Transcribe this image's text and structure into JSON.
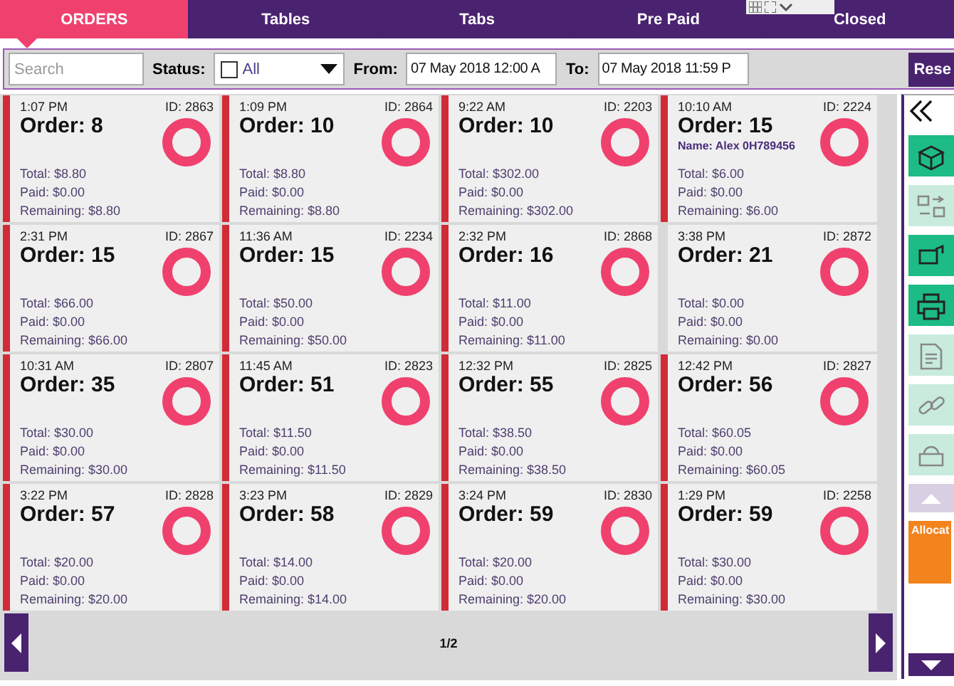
{
  "tabs": [
    {
      "label": "ORDERS",
      "selected": true
    },
    {
      "label": "Tables",
      "selected": false
    },
    {
      "label": "Tabs",
      "selected": false
    },
    {
      "label": "Pre Paid",
      "selected": false
    },
    {
      "label": "Closed",
      "selected": false
    }
  ],
  "filters": {
    "search_placeholder": "Search",
    "status_label": "Status:",
    "status_checked": false,
    "status_value": "All",
    "from_label": "From:",
    "from_value": "07 May 2018 12:00 A",
    "to_label": "To:",
    "to_value": "07 May 2018 11:59 P",
    "reset": "Rese"
  },
  "orders": [
    {
      "time": "1:07 PM",
      "id": "ID: 2863",
      "title": "Order: 8",
      "total": "Total: $8.80",
      "paid": "Paid: $0.00",
      "remaining": "Remaining: $8.80",
      "flagged": true
    },
    {
      "time": "1:09 PM",
      "id": "ID: 2864",
      "title": "Order: 10",
      "total": "Total: $8.80",
      "paid": "Paid: $0.00",
      "remaining": "Remaining: $8.80",
      "flagged": true
    },
    {
      "time": "9:22 AM",
      "id": "ID: 2203",
      "title": "Order: 10",
      "total": "Total: $302.00",
      "paid": "Paid: $0.00",
      "remaining": "Remaining: $302.00",
      "flagged": true
    },
    {
      "time": "10:10 AM",
      "id": "ID: 2224",
      "title": "Order: 15",
      "name": "Name: Alex 0H789456",
      "total": "Total: $6.00",
      "paid": "Paid: $0.00",
      "remaining": "Remaining: $6.00",
      "flagged": true
    },
    {
      "time": "2:31 PM",
      "id": "ID: 2867",
      "title": "Order: 15",
      "total": "Total: $66.00",
      "paid": "Paid: $0.00",
      "remaining": "Remaining: $66.00",
      "flagged": true
    },
    {
      "time": "11:36 AM",
      "id": "ID: 2234",
      "title": "Order: 15",
      "total": "Total: $50.00",
      "paid": "Paid: $0.00",
      "remaining": "Remaining: $50.00",
      "flagged": true
    },
    {
      "time": "2:32 PM",
      "id": "ID: 2868",
      "title": "Order: 16",
      "total": "Total: $11.00",
      "paid": "Paid: $0.00",
      "remaining": "Remaining: $11.00",
      "flagged": true
    },
    {
      "time": "3:38 PM",
      "id": "ID: 2872",
      "title": "Order: 21",
      "total": "Total: $0.00",
      "paid": "Paid: $0.00",
      "remaining": "Remaining: $0.00",
      "flagged": false
    },
    {
      "time": "10:31 AM",
      "id": "ID: 2807",
      "title": "Order: 35",
      "total": "Total: $30.00",
      "paid": "Paid: $0.00",
      "remaining": "Remaining: $30.00",
      "flagged": true
    },
    {
      "time": "11:45 AM",
      "id": "ID: 2823",
      "title": "Order: 51",
      "total": "Total: $11.50",
      "paid": "Paid: $0.00",
      "remaining": "Remaining: $11.50",
      "flagged": true
    },
    {
      "time": "12:32 PM",
      "id": "ID: 2825",
      "title": "Order: 55",
      "total": "Total: $38.50",
      "paid": "Paid: $0.00",
      "remaining": "Remaining: $38.50",
      "flagged": true
    },
    {
      "time": "12:42 PM",
      "id": "ID: 2827",
      "title": "Order: 56",
      "total": "Total: $60.05",
      "paid": "Paid: $0.00",
      "remaining": "Remaining: $60.05",
      "flagged": true
    },
    {
      "time": "3:22 PM",
      "id": "ID: 2828",
      "title": "Order: 57",
      "total": "Total: $20.00",
      "paid": "Paid: $0.00",
      "remaining": "Remaining: $20.00",
      "flagged": true
    },
    {
      "time": "3:23 PM",
      "id": "ID: 2829",
      "title": "Order: 58",
      "total": "Total: $14.00",
      "paid": "Paid: $0.00",
      "remaining": "Remaining: $14.00",
      "flagged": true
    },
    {
      "time": "3:24 PM",
      "id": "ID: 2830",
      "title": "Order: 59",
      "total": "Total: $20.00",
      "paid": "Paid: $0.00",
      "remaining": "Remaining: $20.00",
      "flagged": true
    },
    {
      "time": "1:29 PM",
      "id": "ID: 2258",
      "title": "Order: 59",
      "total": "Total: $30.00",
      "paid": "Paid: $0.00",
      "remaining": "Remaining: $30.00",
      "flagged": true
    }
  ],
  "pager": {
    "page": "1/2"
  },
  "tools": [
    {
      "kind": "box",
      "disabled": false
    },
    {
      "kind": "swap",
      "disabled": true
    },
    {
      "kind": "transfer",
      "disabled": false
    },
    {
      "kind": "printer",
      "disabled": false
    },
    {
      "kind": "note",
      "disabled": true
    },
    {
      "kind": "link",
      "disabled": true
    },
    {
      "kind": "sale",
      "disabled": true
    }
  ],
  "allocation": {
    "label": "Allocat"
  }
}
